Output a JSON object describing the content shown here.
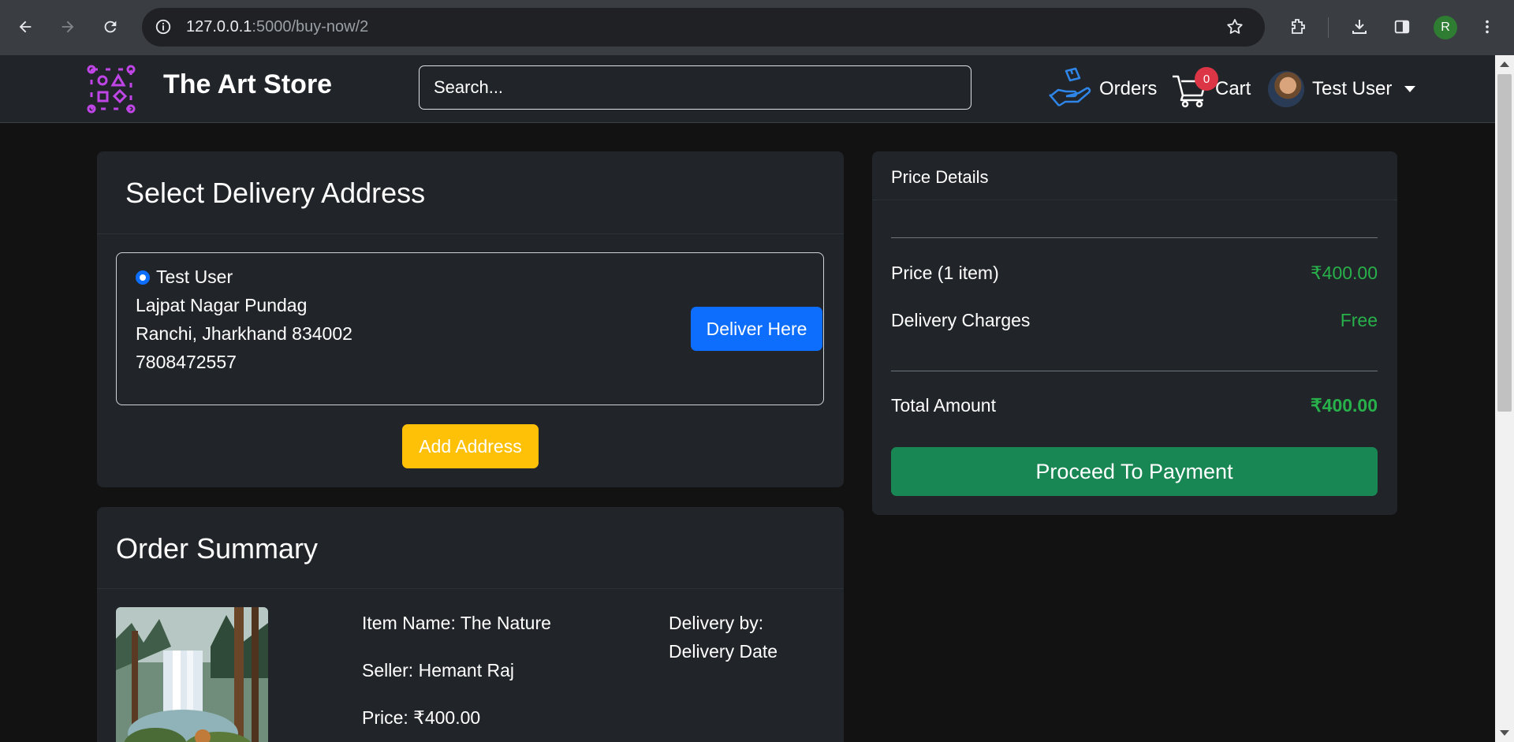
{
  "browser": {
    "url_host": "127.0.0.1",
    "url_path": ":5000/buy-now/2",
    "profile_initial": "R"
  },
  "navbar": {
    "brand": "The Art Store",
    "search_placeholder": "Search...",
    "orders_label": "Orders",
    "cart_label": "Cart",
    "cart_count": "0",
    "user_name": "Test User"
  },
  "address": {
    "title": "Select Delivery Address",
    "name": "Test User",
    "line1": "Lajpat Nagar Pundag",
    "line2": "Ranchi, Jharkhand 834002",
    "phone": "7808472557",
    "deliver_button": "Deliver Here",
    "add_button": "Add Address"
  },
  "order": {
    "title": "Order Summary",
    "item_name": "Item Name: The Nature",
    "seller": "Seller: Hemant Raj",
    "price": "Price:  ₹400.00",
    "delivery_by": "Delivery by:",
    "delivery_date": "Delivery Date"
  },
  "price": {
    "heading": "Price Details",
    "item_label": "Price (1 item)",
    "item_value": "₹400.00",
    "delivery_label": "Delivery Charges",
    "delivery_value": "Free",
    "total_label": "Total Amount",
    "total_value": "₹400.00",
    "pay_button": "Proceed To Payment"
  },
  "colors": {
    "primary": "#0d6efd",
    "warning": "#ffc107",
    "success": "#198754",
    "price_green": "#28b04a"
  }
}
